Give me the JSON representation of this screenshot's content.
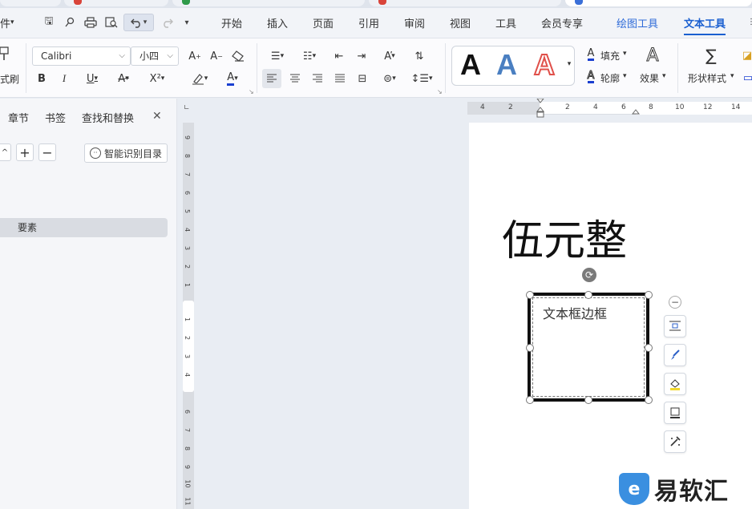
{
  "menu": {
    "file_partial": "件",
    "items": [
      "开始",
      "插入",
      "页面",
      "引用",
      "审阅",
      "视图",
      "工具",
      "会员专享"
    ],
    "context_tabs": [
      "绘图工具",
      "文本工具"
    ],
    "active_tab": "文本工具"
  },
  "ribbon": {
    "format_painter_partial": "式刷",
    "font_name": "Calibri",
    "font_size": "小四",
    "fill_label": "填充",
    "outline_label": "轮廓",
    "effect_label": "效果",
    "shape_style_label": "形状样式",
    "colors": {
      "text_underline": "#1a3fd0",
      "style_blue": "#4a7fc1",
      "style_red": "#e0504a"
    }
  },
  "nav": {
    "tabs": [
      "章节",
      "书签",
      "查找和替换"
    ],
    "close": "✕",
    "expand": "+",
    "collapse": "−",
    "smart_toc": "智能识别目录",
    "items": [
      "要素"
    ]
  },
  "ruler": {
    "h_numbers": [
      "4",
      "2",
      "2",
      "4",
      "6",
      "8",
      "10",
      "12",
      "14"
    ],
    "v_numbers": [
      "9",
      "8",
      "7",
      "6",
      "5",
      "4",
      "3",
      "2",
      "1",
      "1",
      "2",
      "3",
      "4",
      "6",
      "7",
      "8",
      "9",
      "10",
      "11"
    ]
  },
  "document": {
    "heading": "伍元整",
    "textbox_text": "文本框边框"
  },
  "watermark": {
    "logo": "e",
    "text": "易软汇"
  }
}
